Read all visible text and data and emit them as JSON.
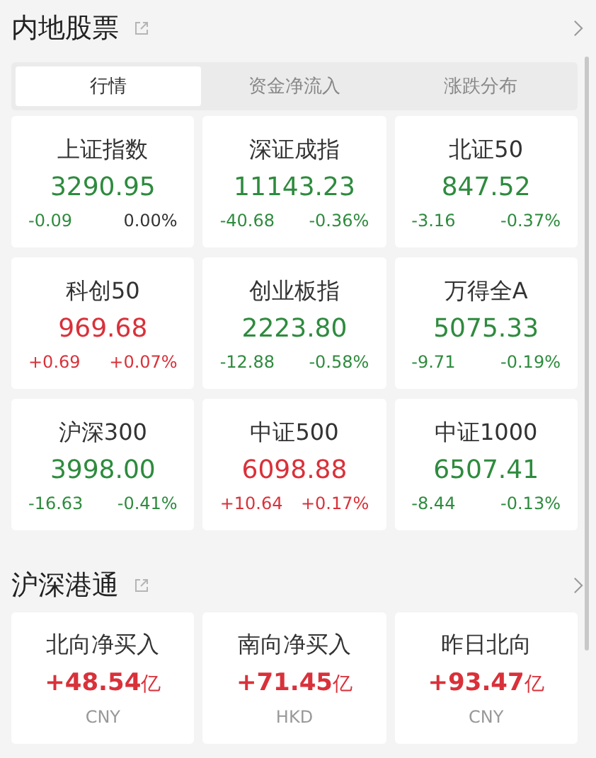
{
  "sections": [
    {
      "title": "内地股票",
      "kind": "indices",
      "tabs": [
        {
          "label": "行情",
          "selected": true
        },
        {
          "label": "资金净流入",
          "selected": false
        },
        {
          "label": "涨跌分布",
          "selected": false
        }
      ],
      "cards": [
        {
          "name": "上证指数",
          "value": "3290.95",
          "color": "#2e8b3e",
          "change": {
            "text": "-0.09",
            "color": "#2e8b3e"
          },
          "pct": {
            "text": "0.00%",
            "color": "#333333"
          }
        },
        {
          "name": "深证成指",
          "value": "11143.23",
          "color": "#2e8b3e",
          "change": {
            "text": "-40.68",
            "color": "#2e8b3e"
          },
          "pct": {
            "text": "-0.36%",
            "color": "#2e8b3e"
          }
        },
        {
          "name": "北证50",
          "value": "847.52",
          "color": "#2e8b3e",
          "change": {
            "text": "-3.16",
            "color": "#2e8b3e"
          },
          "pct": {
            "text": "-0.37%",
            "color": "#2e8b3e"
          }
        },
        {
          "name": "科创50",
          "value": "969.68",
          "color": "#d9313a",
          "change": {
            "text": "+0.69",
            "color": "#d9313a"
          },
          "pct": {
            "text": "+0.07%",
            "color": "#d9313a"
          }
        },
        {
          "name": "创业板指",
          "value": "2223.80",
          "color": "#2e8b3e",
          "change": {
            "text": "-12.88",
            "color": "#2e8b3e"
          },
          "pct": {
            "text": "-0.58%",
            "color": "#2e8b3e"
          }
        },
        {
          "name": "万得全A",
          "value": "5075.33",
          "color": "#2e8b3e",
          "change": {
            "text": "-9.71",
            "color": "#2e8b3e"
          },
          "pct": {
            "text": "-0.19%",
            "color": "#2e8b3e"
          }
        },
        {
          "name": "沪深300",
          "value": "3998.00",
          "color": "#2e8b3e",
          "change": {
            "text": "-16.63",
            "color": "#2e8b3e"
          },
          "pct": {
            "text": "-0.41%",
            "color": "#2e8b3e"
          }
        },
        {
          "name": "中证500",
          "value": "6098.88",
          "color": "#d9313a",
          "change": {
            "text": "+10.64",
            "color": "#d9313a"
          },
          "pct": {
            "text": "+0.17%",
            "color": "#d9313a"
          }
        },
        {
          "name": "中证1000",
          "value": "6507.41",
          "color": "#2e8b3e",
          "change": {
            "text": "-8.44",
            "color": "#2e8b3e"
          },
          "pct": {
            "text": "-0.13%",
            "color": "#2e8b3e"
          }
        }
      ]
    },
    {
      "title": "沪深港通",
      "kind": "flows",
      "cards": [
        {
          "name": "北向净买入",
          "value": "+48.54",
          "unit": "亿",
          "color": "#d9313a",
          "currency": "CNY"
        },
        {
          "name": "南向净买入",
          "value": "+71.45",
          "unit": "亿",
          "color": "#d9313a",
          "currency": "HKD"
        },
        {
          "name": "昨日北向",
          "value": "+93.47",
          "unit": "亿",
          "color": "#d9313a",
          "currency": "CNY"
        }
      ]
    }
  ]
}
